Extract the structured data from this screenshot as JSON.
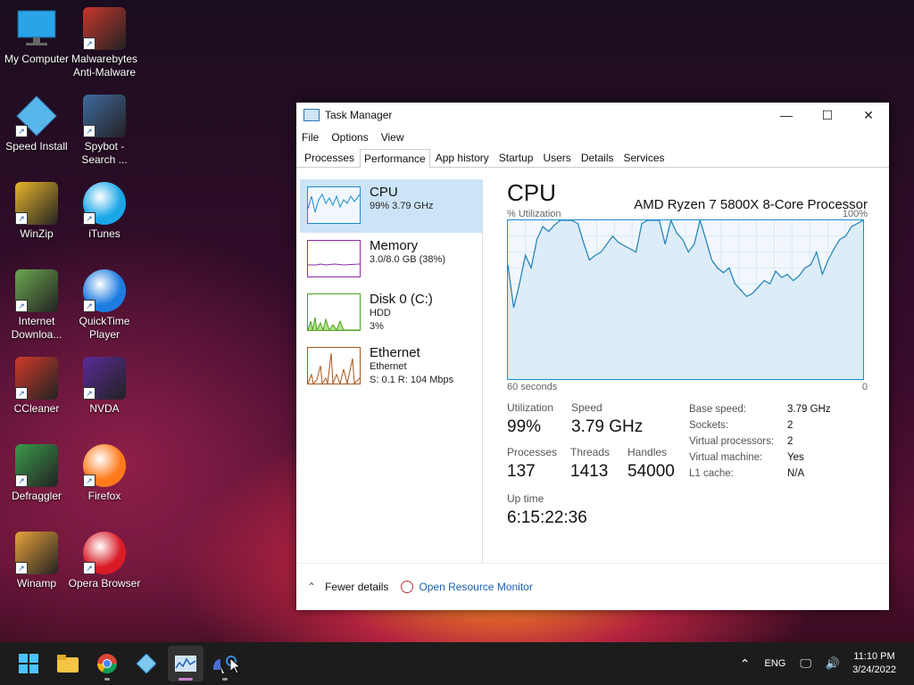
{
  "desktop_icons": [
    {
      "label": "My Computer",
      "kind": "monitor"
    },
    {
      "label": "Malwarebytes Anti-Malware",
      "kind": "malwarebytes"
    },
    {
      "label": "Speed Install",
      "kind": "diamond"
    },
    {
      "label": "Spybot - Search ...",
      "kind": "spybot"
    },
    {
      "label": "WinZip",
      "kind": "winzip"
    },
    {
      "label": "iTunes",
      "kind": "itunes"
    },
    {
      "label": "Internet Downloa...",
      "kind": "idm"
    },
    {
      "label": "QuickTime Player",
      "kind": "quicktime"
    },
    {
      "label": "CCleaner",
      "kind": "ccleaner"
    },
    {
      "label": "NVDA",
      "kind": "nvda"
    },
    {
      "label": "Defraggler",
      "kind": "defraggler"
    },
    {
      "label": "Firefox",
      "kind": "firefox"
    },
    {
      "label": "Winamp",
      "kind": "winamp"
    },
    {
      "label": "Opera Browser",
      "kind": "opera"
    }
  ],
  "window": {
    "title": "Task Manager",
    "controls": {
      "minimize": "—",
      "maximize": "☐",
      "close": "✕"
    },
    "menu": [
      "File",
      "Options",
      "View"
    ],
    "tabs": [
      "Processes",
      "Performance",
      "App history",
      "Startup",
      "Users",
      "Details",
      "Services"
    ],
    "active_tab": "Performance"
  },
  "resources": [
    {
      "name": "CPU",
      "line1": "99%  3.79 GHz",
      "line2": "",
      "line3": "",
      "selected": true,
      "color": "#1a8bd0"
    },
    {
      "name": "Memory",
      "line1": "3.0/8.0 GB (38%)",
      "line2": "",
      "line3": "",
      "selected": false,
      "color": "#8b2aa8"
    },
    {
      "name": "Disk 0 (C:)",
      "line1": "HDD",
      "line2": "3%",
      "line3": "",
      "selected": false,
      "color": "#4ca21f"
    },
    {
      "name": "Ethernet",
      "line1": "Ethernet",
      "line2": "S: 0.1  R: 104 Mbps",
      "line3": "",
      "selected": false,
      "color": "#a7561c"
    }
  ],
  "cpu": {
    "title": "CPU",
    "model": "AMD Ryzen 7 5800X 8-Core Processor",
    "graph_label": "% Utilization",
    "graph_max": "100%",
    "graph_time": "60 seconds",
    "graph_zero": "0",
    "utilization_label": "Utilization",
    "utilization": "99%",
    "speed_label": "Speed",
    "speed": "3.79 GHz",
    "processes_label": "Processes",
    "processes": "137",
    "threads_label": "Threads",
    "threads": "1413",
    "handles_label": "Handles",
    "handles": "54000",
    "uptime_label": "Up time",
    "uptime": "6:15:22:36",
    "details": [
      {
        "k": "Base speed:",
        "v": "3.79 GHz"
      },
      {
        "k": "Sockets:",
        "v": "2"
      },
      {
        "k": "Virtual processors:",
        "v": "2"
      },
      {
        "k": "Virtual machine:",
        "v": "Yes"
      },
      {
        "k": "L1 cache:",
        "v": "N/A"
      }
    ]
  },
  "cpu_history": [
    72,
    45,
    60,
    78,
    70,
    88,
    96,
    93,
    97,
    100,
    100,
    100,
    98,
    86,
    75,
    78,
    80,
    85,
    90,
    86,
    84,
    82,
    80,
    98,
    100,
    100,
    100,
    85,
    100,
    92,
    88,
    80,
    85,
    100,
    88,
    75,
    70,
    67,
    70,
    60,
    56,
    52,
    54,
    58,
    62,
    60,
    68,
    64,
    66,
    62,
    65,
    70,
    72,
    80,
    66,
    75,
    82,
    88,
    90,
    96,
    98,
    100
  ],
  "footer": {
    "fewer": "Fewer details",
    "open": "Open Resource Monitor"
  },
  "taskbar": {
    "apps": [
      "start-icon",
      "file-explorer-icon",
      "chrome-icon",
      "speed-install-icon",
      "task-manager-icon",
      "nvda-icon"
    ],
    "tray_lang": "ENG",
    "time": "11:10 PM",
    "date": "3/24/2022"
  }
}
